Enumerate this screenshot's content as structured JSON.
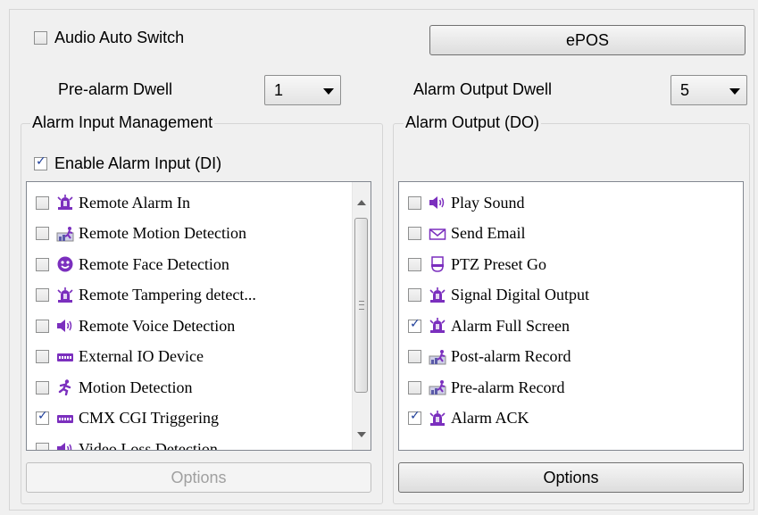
{
  "audio_auto_switch": {
    "label": "Audio Auto Switch",
    "checked": false
  },
  "epos_button": {
    "label": "ePOS"
  },
  "pre_alarm_dwell": {
    "label": "Pre-alarm Dwell",
    "value": "1"
  },
  "alarm_output_dwell": {
    "label": "Alarm Output Dwell",
    "value": "5"
  },
  "alarm_input_management": {
    "title": "Alarm Input Management",
    "enable": {
      "label": "Enable Alarm Input (DI)",
      "checked": true
    },
    "items": [
      {
        "label": "Remote Alarm In",
        "icon": "alarm-siren-icon",
        "checked": false
      },
      {
        "label": "Remote Motion Detection",
        "icon": "motion-chart-icon",
        "checked": false
      },
      {
        "label": "Remote Face Detection",
        "icon": "face-icon",
        "checked": false
      },
      {
        "label": "Remote Tampering detect...",
        "icon": "alarm-siren-icon",
        "checked": false
      },
      {
        "label": "Remote Voice Detection",
        "icon": "speaker-icon",
        "checked": false
      },
      {
        "label": "External IO Device",
        "icon": "io-device-icon",
        "checked": false
      },
      {
        "label": "Motion Detection",
        "icon": "running-man-icon",
        "checked": false
      },
      {
        "label": "CMX CGI Triggering",
        "icon": "io-device-icon",
        "checked": true
      },
      {
        "label": "Video Loss Detection",
        "icon": "speaker-icon",
        "checked": false
      }
    ],
    "options_label": "Options"
  },
  "alarm_output": {
    "title": "Alarm Output (DO)",
    "items": [
      {
        "label": "Play Sound",
        "icon": "speaker-icon",
        "checked": false
      },
      {
        "label": "Send Email",
        "icon": "envelope-icon",
        "checked": false
      },
      {
        "label": "PTZ Preset Go",
        "icon": "ptz-camera-icon",
        "checked": false
      },
      {
        "label": "Signal Digital Output",
        "icon": "alarm-siren-icon",
        "checked": false
      },
      {
        "label": "Alarm Full Screen",
        "icon": "alarm-siren-icon",
        "checked": true
      },
      {
        "label": "Post-alarm Record",
        "icon": "motion-chart-icon",
        "checked": false
      },
      {
        "label": "Pre-alarm Record",
        "icon": "motion-chart-icon",
        "checked": false
      },
      {
        "label": "Alarm ACK",
        "icon": "alarm-siren-icon",
        "checked": true
      }
    ],
    "options_label": "Options"
  },
  "colors": {
    "icon_purple": "#7b2fbe",
    "check_blue": "#1f3f9a",
    "disabled_text": "#a0a0a0"
  }
}
